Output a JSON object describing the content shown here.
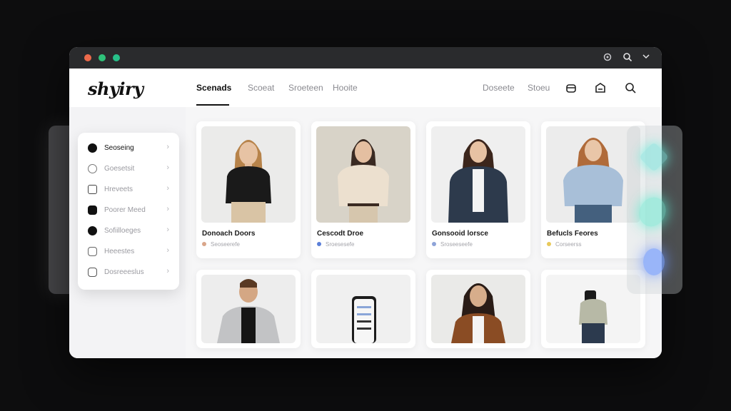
{
  "titlebar": {
    "icons": [
      "settings-icon",
      "search-icon",
      "chevron-down-icon"
    ]
  },
  "brand": {
    "logo": "shyiry"
  },
  "nav": {
    "items": [
      "Scenads",
      "Scoeat",
      "Sroeteen",
      "Hooite"
    ],
    "right_items": [
      "Doseete",
      "Stoeu"
    ]
  },
  "header_icons": [
    "bag-icon",
    "cart-icon",
    "search-icon"
  ],
  "sidebar": {
    "items": [
      {
        "label": "Seoseing",
        "icon": "filled-circle-icon",
        "active": true
      },
      {
        "label": "Goesetsit",
        "icon": "coin-icon",
        "active": false
      },
      {
        "label": "Hreveets",
        "icon": "card-icon",
        "active": false
      },
      {
        "label": "Poorer Meed",
        "icon": "profile-icon",
        "active": false
      },
      {
        "label": "Sofiilloeges",
        "icon": "circle-icon",
        "active": false
      },
      {
        "label": "Heeestes",
        "icon": "smile-icon",
        "active": false
      },
      {
        "label": "Dosreeeslus",
        "icon": "lock-icon",
        "active": false
      }
    ]
  },
  "products": [
    {
      "name": "Donoach Doors",
      "sub": "Seoseerefe",
      "swatch": "#d9a58a"
    },
    {
      "name": "Cescodt Droe",
      "sub": "Sroesesefe",
      "swatch": "#5b7fd8"
    },
    {
      "name": "Gonsooid lorsce",
      "sub": "Sroseeseefe",
      "swatch": "#8ea3d8"
    },
    {
      "name": "Befucls Feores",
      "sub": "Corseerss",
      "swatch": "#e8c95a"
    },
    {
      "name": "",
      "sub": "",
      "swatch": ""
    },
    {
      "name": "",
      "sub": "",
      "swatch": ""
    },
    {
      "name": "",
      "sub": "",
      "swatch": ""
    },
    {
      "name": "",
      "sub": "",
      "swatch": ""
    }
  ]
}
